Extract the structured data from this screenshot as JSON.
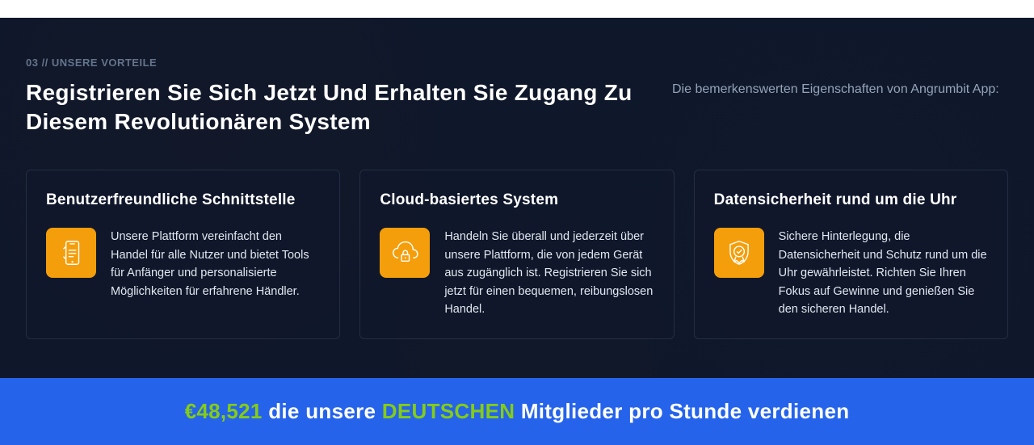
{
  "eyebrow": "03 // UNSERE VORTEILE",
  "headline": "Registrieren Sie Sich Jetzt Und Erhalten Sie Zugang Zu Diesem Revolutionären System",
  "subtext": "Die bemerkenswerten Eigenschaften von Angrumbit App:",
  "cards": [
    {
      "title": "Benutzerfreundliche Schnittstelle",
      "desc": "Unsere Plattform vereinfacht den Handel für alle Nutzer und bietet Tools für Anfänger und personalisierte Möglichkeiten für erfahrene Händler."
    },
    {
      "title": "Cloud-basiertes System",
      "desc": "Handeln Sie überall und jederzeit über unsere Plattform, die von jedem Gerät aus zugänglich ist. Registrieren Sie sich jetzt für einen bequemen, reibungslosen Handel."
    },
    {
      "title": "Datensicherheit rund um die Uhr",
      "desc": "Sichere Hinterlegung, die Datensicherheit und Schutz rund um die Uhr gewährleistet. Richten Sie Ihren Fokus auf Gewinne und genießen Sie den sicheren Handel."
    }
  ],
  "banner": {
    "amount": "€48,521",
    "mid1": " die unsere ",
    "highlight": "DEUTSCHEN",
    "mid2": " Mitglieder pro Stunde verdienen"
  }
}
